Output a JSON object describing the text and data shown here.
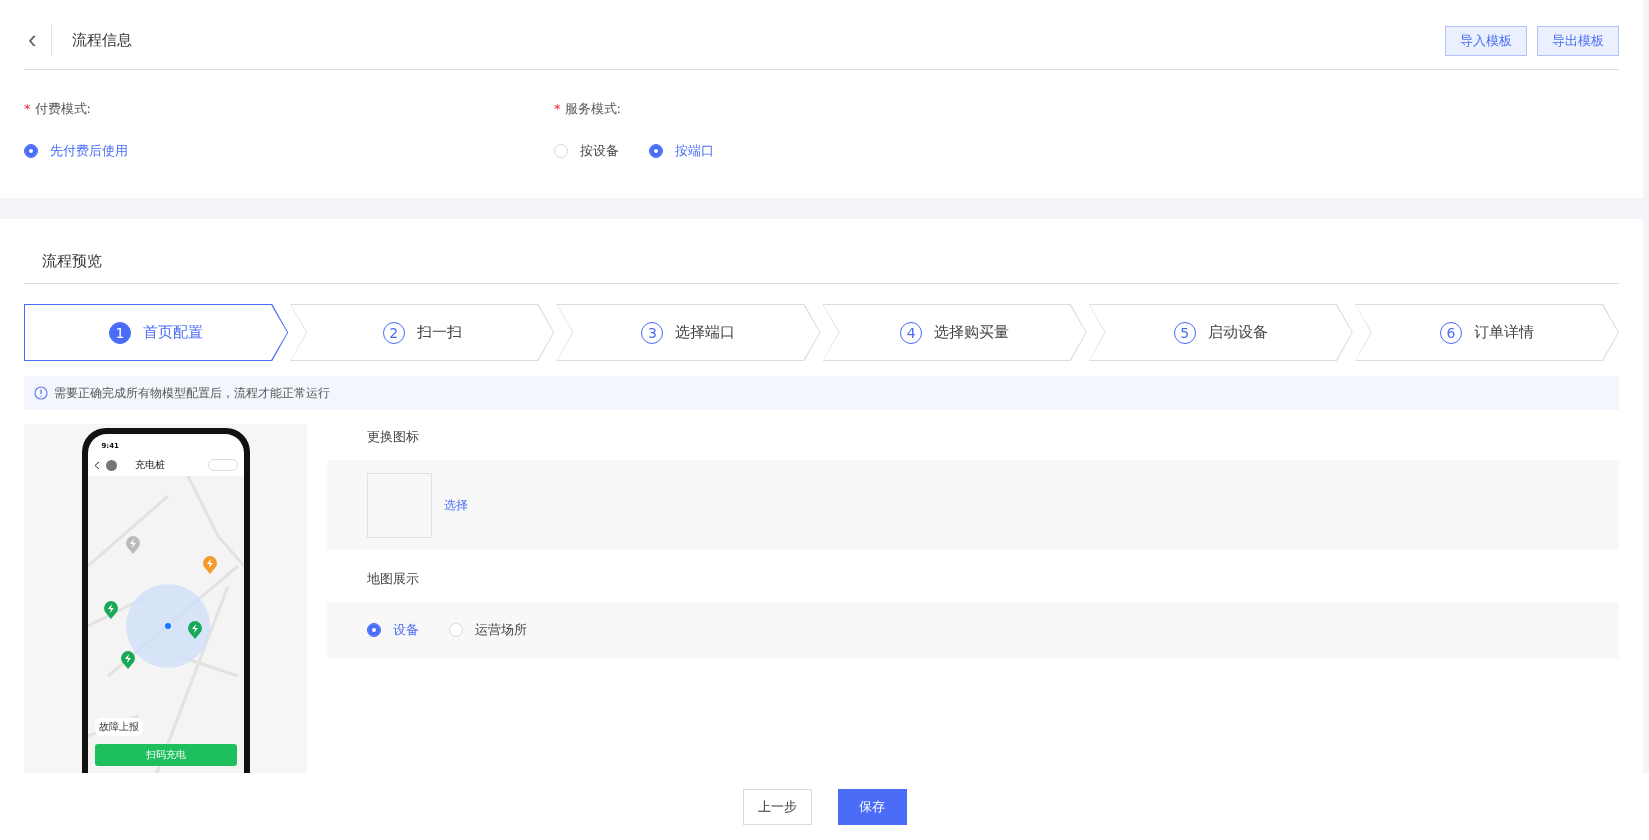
{
  "header": {
    "back": "‹",
    "title": "流程信息",
    "buttons": [
      "导入模板",
      "导出模板"
    ]
  },
  "payment": {
    "label": "付费模式:",
    "required_mark": "*",
    "options": [
      {
        "label": "先付费后使用",
        "selected": true
      }
    ]
  },
  "service": {
    "label": "服务模式:",
    "required_mark": "*",
    "options": [
      {
        "label": "按设备",
        "selected": false
      },
      {
        "label": "按端口",
        "selected": true
      }
    ]
  },
  "preview": {
    "title": "流程预览"
  },
  "steps": [
    {
      "number": "1",
      "label": "首页配置",
      "selected": true
    },
    {
      "number": "2",
      "label": "扫一扫",
      "selected": false
    },
    {
      "number": "3",
      "label": "选择端口",
      "selected": false
    },
    {
      "number": "4",
      "label": "选择购买量",
      "selected": false
    },
    {
      "number": "5",
      "label": "启动设备",
      "selected": false
    },
    {
      "number": "6",
      "label": "订单详情",
      "selected": false
    }
  ],
  "notice": "需要正确完成所有物模型配置后，流程才能正常运行",
  "phone": {
    "time": "9:41",
    "title": "充电桩",
    "report": "故障上报",
    "button": "扫码充电"
  },
  "icon_section": {
    "title": "更换图标",
    "link": "选择"
  },
  "map_section": {
    "title": "地图展示",
    "options": [
      {
        "label": "设备",
        "selected": true
      },
      {
        "label": "运营场所",
        "selected": false
      }
    ]
  },
  "footer": {
    "buttons": [
      {
        "label": "上一步",
        "kind": "default"
      },
      {
        "label": "保存",
        "kind": "primary"
      }
    ]
  }
}
